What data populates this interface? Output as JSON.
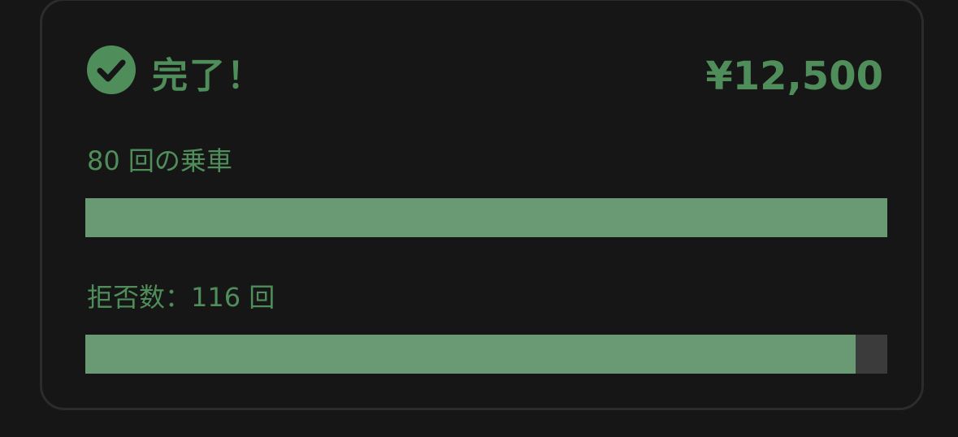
{
  "card": {
    "status_label": "完了！",
    "amount": "¥12,500",
    "rides_label": "80 回の乗車",
    "rides_progress": 1.0,
    "rejects_label": "拒否数：116 回",
    "rejects_progress": 0.96
  },
  "colors": {
    "accent": "#4f8e5b",
    "bar_fill": "#6a9a74",
    "bar_track": "#3b3b3b",
    "background": "#161616",
    "card_border": "#2c2c2c"
  },
  "icons": {
    "status": "check-circle-icon"
  }
}
